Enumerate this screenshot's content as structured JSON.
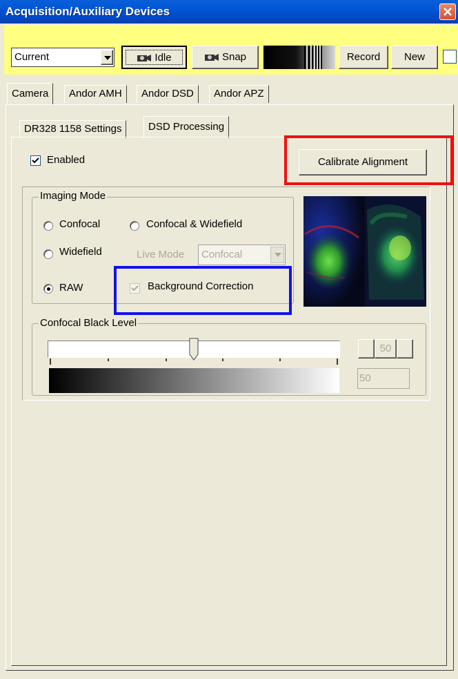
{
  "window": {
    "title": "Acquisition/Auxiliary Devices"
  },
  "toolbar": {
    "preset_value": "Current",
    "idle_label": "Idle",
    "snap_label": "Snap",
    "record_label": "Record",
    "new_label": "New"
  },
  "camera_tabs": [
    "Camera",
    "Andor AMH",
    "Andor DSD",
    "Andor APZ"
  ],
  "settings_tabs": [
    "DR328 1158 Settings",
    "DSD Processing"
  ],
  "active_settings_tab": "DSD Processing",
  "dsd": {
    "enabled_label": "Enabled",
    "enabled_checked": true,
    "calibrate_label": "Calibrate Alignment"
  },
  "imaging_mode": {
    "group_label": "Imaging Mode",
    "options": {
      "confocal": "Confocal",
      "confocal_widefield": "Confocal & Widefield",
      "widefield": "Widefield",
      "raw": "RAW"
    },
    "selected": "RAW",
    "live_mode_label": "Live Mode",
    "live_mode_value": "Confocal",
    "background_correction_label": "Background Correction",
    "background_correction_checked": true
  },
  "black_level": {
    "group_label": "Confocal Black Level",
    "slider_value_fraction": 0.5,
    "button_value": "50",
    "field_value": "50"
  },
  "colors": {
    "titlebar": "#0056d6",
    "toolbar_bg": "#ffff80",
    "panel_bg": "#ece9d8",
    "highlight_red": "#ee1111",
    "highlight_blue": "#1111ee"
  }
}
